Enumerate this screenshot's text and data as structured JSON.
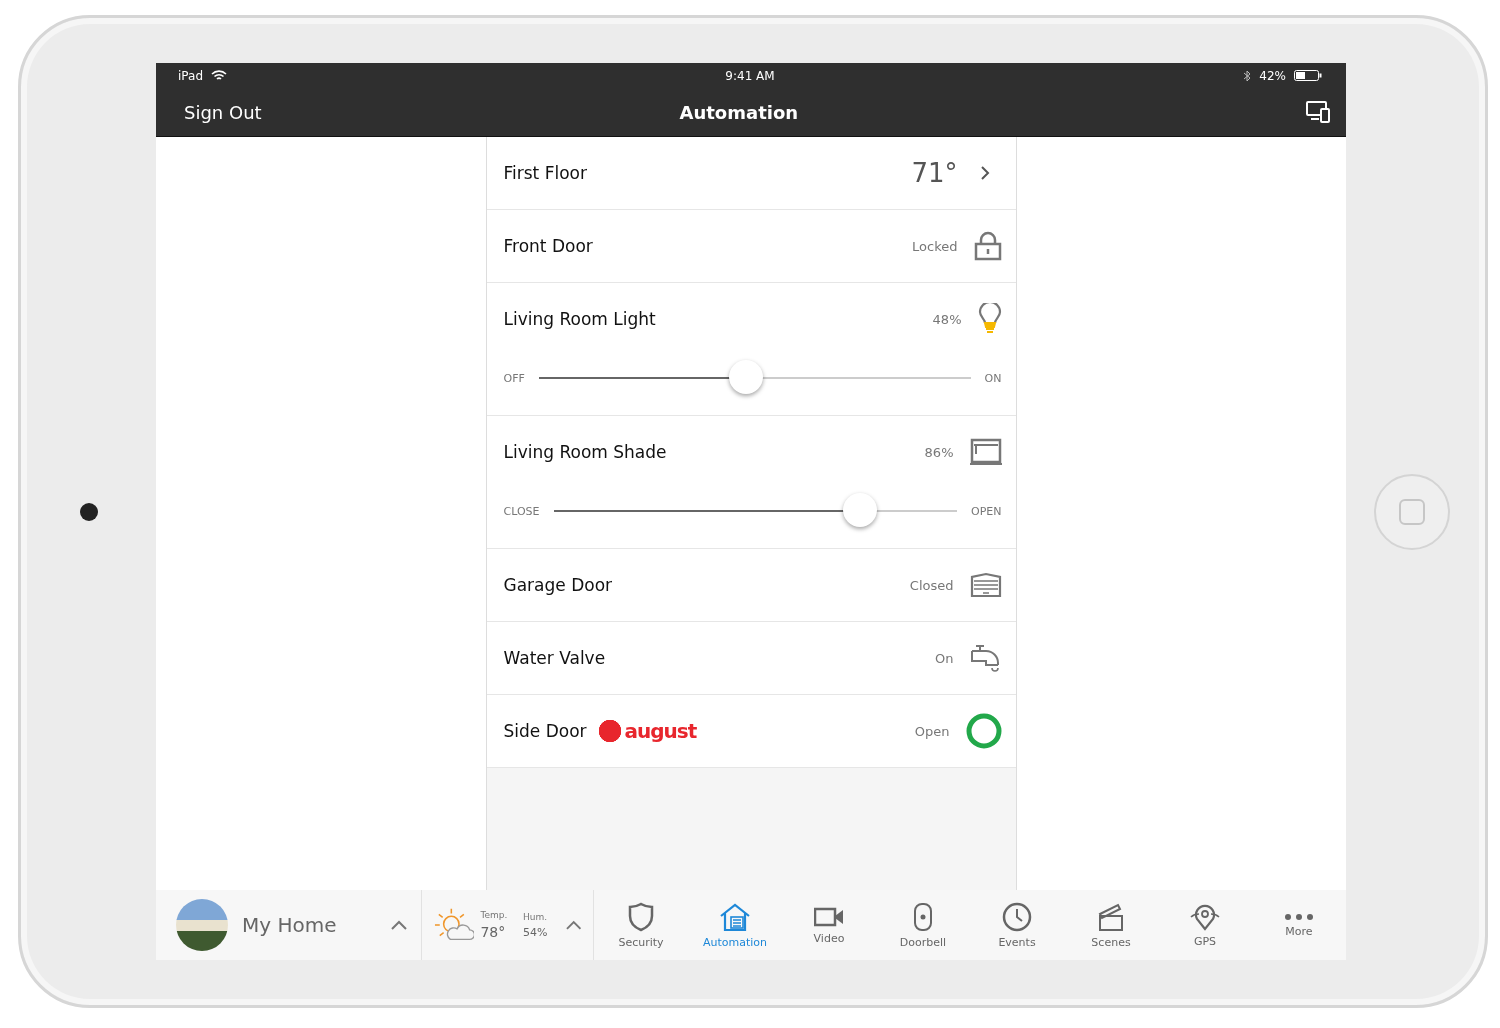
{
  "status_bar": {
    "device": "iPad",
    "time": "9:41 AM",
    "battery": "42%"
  },
  "nav_bar": {
    "left_button": "Sign Out",
    "title": "Automation"
  },
  "devices": [
    {
      "kind": "thermostat",
      "name": "First Floor",
      "value": "71°"
    },
    {
      "kind": "lock",
      "name": "Front Door",
      "value": "Locked"
    },
    {
      "kind": "light",
      "name": "Living Room Light",
      "value": "48%",
      "slider": {
        "level": 0.48,
        "min_label": "OFF",
        "max_label": "ON"
      }
    },
    {
      "kind": "shade",
      "name": "Living Room Shade",
      "value": "86%",
      "slider": {
        "level": 0.76,
        "min_label": "CLOSE",
        "max_label": "OPEN"
      }
    },
    {
      "kind": "garage",
      "name": "Garage Door",
      "value": "Closed"
    },
    {
      "kind": "valve",
      "name": "Water Valve",
      "value": "On"
    },
    {
      "kind": "smart_lock",
      "name": "Side Door",
      "brand": "august",
      "value": "Open"
    }
  ],
  "home": {
    "name": "My Home"
  },
  "weather": {
    "temp_label": "Temp.",
    "temp": "78°",
    "hum_label": "Hum.",
    "hum": "54%"
  },
  "tabs": [
    {
      "label": "Security",
      "selected": false
    },
    {
      "label": "Automation",
      "selected": true
    },
    {
      "label": "Video",
      "selected": false
    },
    {
      "label": "Doorbell",
      "selected": false
    },
    {
      "label": "Events",
      "selected": false
    },
    {
      "label": "Scenes",
      "selected": false
    },
    {
      "label": "GPS",
      "selected": false
    },
    {
      "label": "More",
      "selected": false
    }
  ]
}
